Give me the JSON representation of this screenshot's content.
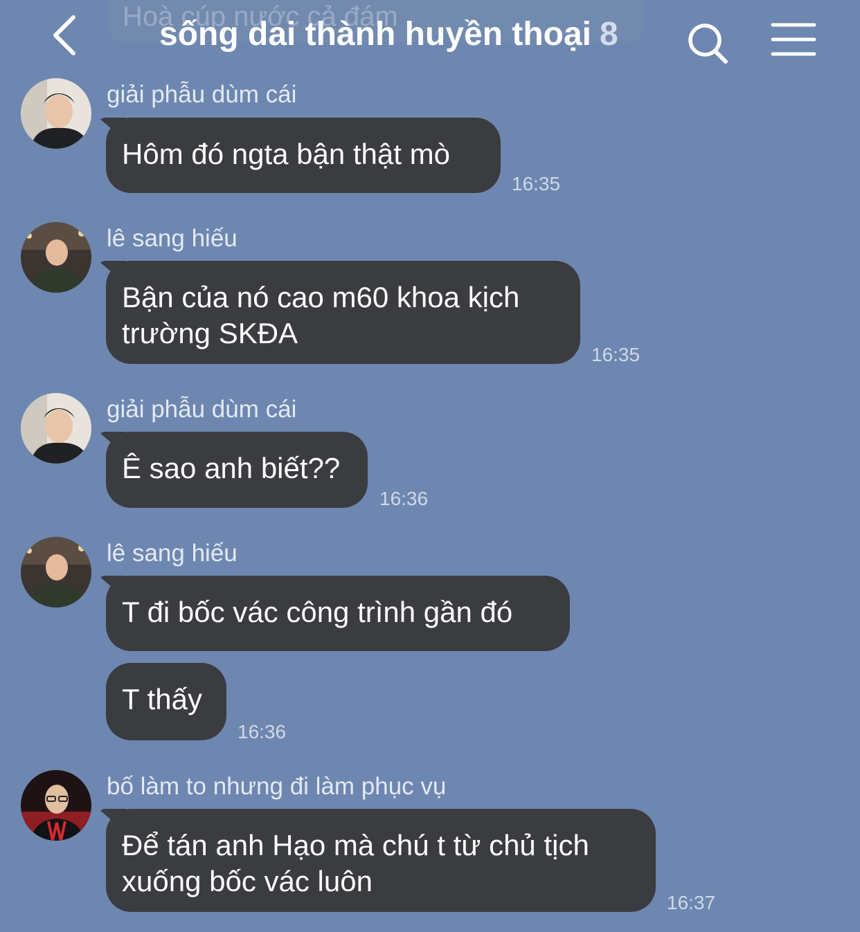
{
  "header": {
    "pinned_preview": "Hoà cúp nước cả đám",
    "title": "sống dai thành huyền thoại",
    "member_count": "8"
  },
  "icons": {
    "back": "chevron-left-icon",
    "search": "search-icon",
    "menu": "hamburger-menu-icon"
  },
  "messages": [
    {
      "sender": "giải phẫu dùm cái",
      "text": "Hôm đó ngta bận thật mò",
      "time": "16:35"
    },
    {
      "sender": "lê sang hiếu",
      "line1": "Bận của nó cao m60 khoa kịch",
      "line2": "trường SKĐA",
      "time": "16:35"
    },
    {
      "sender": "giải phẫu dùm cái",
      "text": "Ê sao anh biết??",
      "time": "16:36"
    },
    {
      "sender": "lê sang hiếu",
      "text": "T đi bốc vác công trình gần đó"
    },
    {
      "text": "T thấy",
      "time": "16:36"
    },
    {
      "sender": "bố làm to nhưng đi làm phục vụ",
      "line1": "Để tán anh Hạo mà chú t từ chủ tịch",
      "line2": "xuống bốc vác luôn",
      "time": "16:37"
    }
  ],
  "colors": {
    "background": "#6d87b0",
    "bubble": "#3b3c40",
    "text": "#ffffff"
  }
}
